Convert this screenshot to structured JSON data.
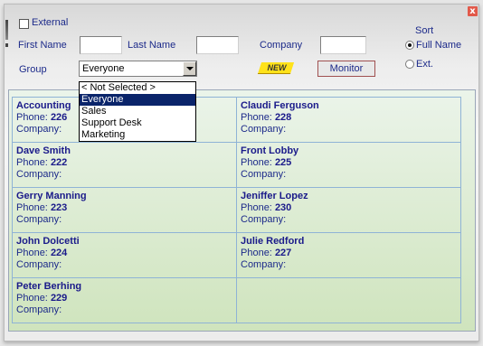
{
  "external": {
    "label": "External",
    "checked": false
  },
  "filters": {
    "first_name_label": "First Name",
    "first_name_value": "",
    "last_name_label": "Last Name",
    "last_name_value": "",
    "company_label": "Company",
    "company_value": "",
    "group_label": "Group",
    "group_value": "Everyone"
  },
  "sort": {
    "label": "Sort",
    "options": [
      {
        "label": "Full Name",
        "selected": true
      },
      {
        "label": "Ext.",
        "selected": false
      }
    ]
  },
  "buttons": {
    "new_label": "NEW",
    "monitor_label": "Monitor",
    "close_glyph": "x"
  },
  "group_dropdown": {
    "options": [
      "< Not Selected >",
      "Everyone",
      "Sales",
      "Support Desk",
      "Marketing"
    ],
    "highlighted": "Everyone"
  },
  "field_labels": {
    "phone": "Phone:",
    "company": "Company:"
  },
  "contacts": [
    {
      "name": "Accounting",
      "phone": "226",
      "company": ""
    },
    {
      "name": "Claudi Ferguson",
      "phone": "228",
      "company": ""
    },
    {
      "name": "Dave Smith",
      "phone": "222",
      "company": ""
    },
    {
      "name": "Front Lobby",
      "phone": "225",
      "company": ""
    },
    {
      "name": "Gerry Manning",
      "phone": "223",
      "company": ""
    },
    {
      "name": "Jeniffer Lopez",
      "phone": "230",
      "company": ""
    },
    {
      "name": "John Dolcetti",
      "phone": "224",
      "company": ""
    },
    {
      "name": "Julie Redford",
      "phone": "227",
      "company": ""
    },
    {
      "name": "Peter Berhing",
      "phone": "229",
      "company": ""
    }
  ],
  "colors": {
    "accent_text": "#1c2a8a",
    "highlight": "#0a246a",
    "new_badge": "#ffe21a",
    "close": "#e2594a"
  }
}
